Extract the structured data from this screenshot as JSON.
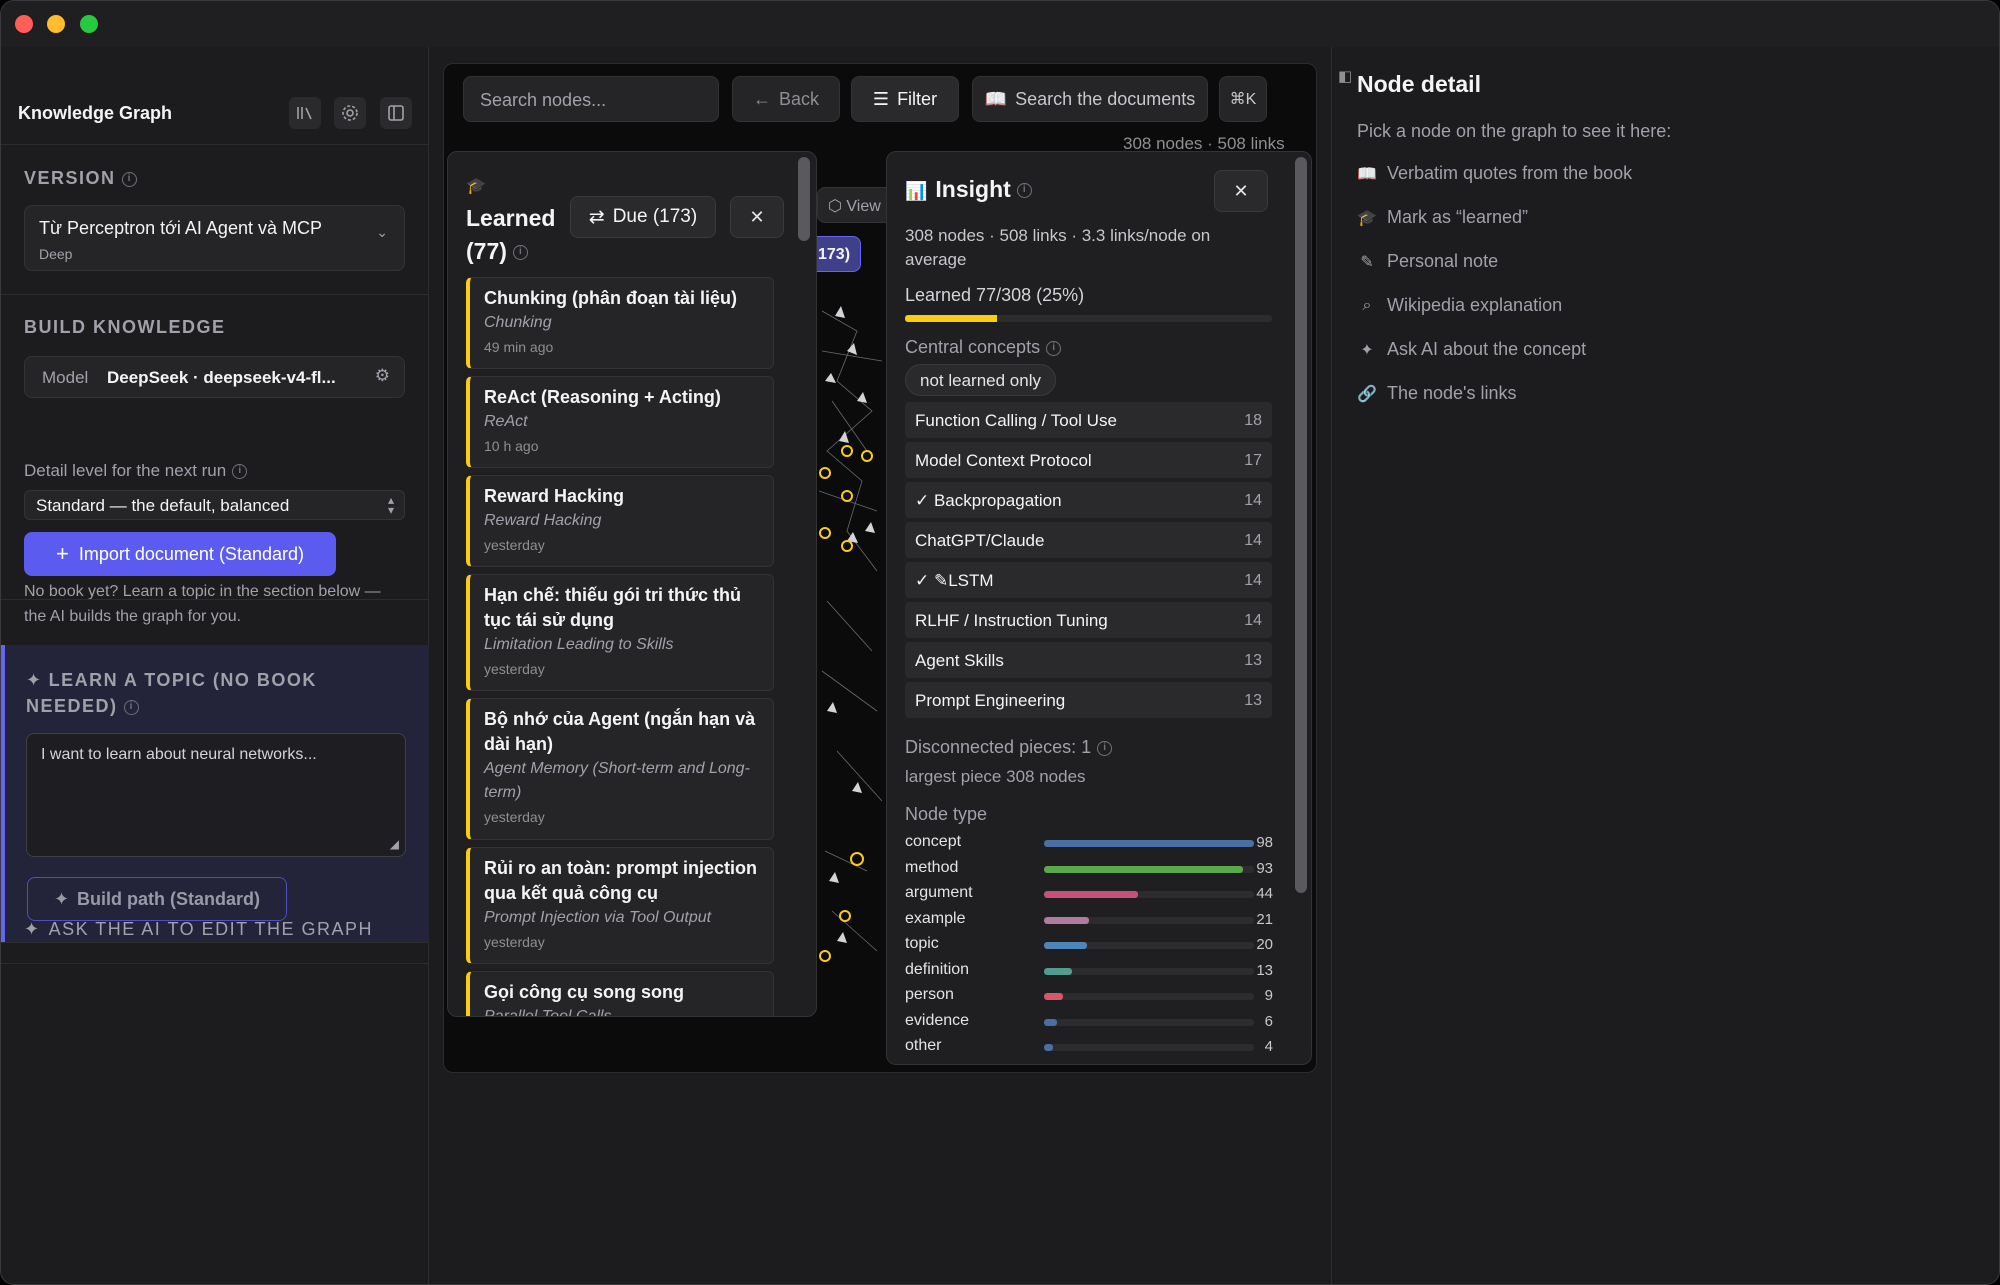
{
  "sidebar": {
    "title": "Knowledge Graph",
    "version_label": "VERSION",
    "version_name": "Từ Perceptron tới AI Agent và MCP",
    "version_sub": "Deep",
    "build_label": "BUILD KNOWLEDGE",
    "model_key": "Model",
    "model_val": "DeepSeek · deepseek-v4-fl...",
    "detail_label": "Detail level for the next run",
    "detail_value": "Standard — the default, balanced",
    "import_btn": "Import document (Standard)",
    "hint": "No book yet? Learn a topic in the section below — the AI builds the graph for you.",
    "learn_title": "LEARN A TOPIC (NO BOOK NEEDED)",
    "learn_placeholder": "I want to learn about neural networks...",
    "build_path_btn": "Build path (Standard)",
    "ask_ai": "ASK THE AI TO EDIT THE GRAPH"
  },
  "toolbar": {
    "search_placeholder": "Search nodes...",
    "back": "Back",
    "filter": "Filter",
    "search_docs": "Search the documents",
    "shortcut": "⌘K",
    "counts": "308 nodes · 508 links",
    "view_partial": "View",
    "due_partial": "173)"
  },
  "learned": {
    "title": "Learned (77)",
    "due_btn": "Due (173)",
    "cards": [
      {
        "title": "Chunking (phân đoạn tài liệu)",
        "sub": "Chunking",
        "time": "49 min ago"
      },
      {
        "title": "ReAct (Reasoning + Acting)",
        "sub": "ReAct",
        "time": "10 h ago"
      },
      {
        "title": "Reward Hacking",
        "sub": "Reward Hacking",
        "time": "yesterday"
      },
      {
        "title": "Hạn chế: thiếu gói tri thức thủ tục tái sử dụng",
        "sub": "Limitation Leading to Skills",
        "time": "yesterday"
      },
      {
        "title": "Bộ nhớ của Agent (ngắn hạn và dài hạn)",
        "sub": "Agent Memory (Short-term and Long-term)",
        "time": "yesterday"
      },
      {
        "title": "Rủi ro an toàn: prompt injection qua kết quả công cụ",
        "sub": "Prompt Injection via Tool Output",
        "time": "yesterday"
      },
      {
        "title": "Gọi công cụ song song",
        "sub": "Parallel Tool Calls",
        "time": ""
      }
    ]
  },
  "insight": {
    "title": "Insight",
    "stats": "308 nodes · 508 links · 3.3 links/node on average",
    "learned": "Learned 77/308 (25%)",
    "learned_fraction": 0.25,
    "central_label": "Central concepts",
    "filter_pill": "not learned only",
    "concepts": [
      {
        "name": "Function Calling / Tool Use",
        "count": "18",
        "prefix": ""
      },
      {
        "name": "Model Context Protocol",
        "count": "17",
        "prefix": ""
      },
      {
        "name": "Backpropagation",
        "count": "14",
        "prefix": "✓ "
      },
      {
        "name": "ChatGPT/Claude",
        "count": "14",
        "prefix": ""
      },
      {
        "name": "LSTM",
        "count": "14",
        "prefix": "✓ ✎"
      },
      {
        "name": "RLHF / Instruction Tuning",
        "count": "14",
        "prefix": ""
      },
      {
        "name": "Agent Skills",
        "count": "13",
        "prefix": ""
      },
      {
        "name": "Prompt Engineering",
        "count": "13",
        "prefix": ""
      }
    ],
    "disconnected": "Disconnected pieces: 1",
    "largest": "largest piece 308 nodes",
    "node_type_label": "Node type",
    "node_types": [
      {
        "label": "concept",
        "count": "98",
        "value": 98,
        "color": "#4a6fa5"
      },
      {
        "label": "method",
        "count": "93",
        "value": 93,
        "color": "#5aa94a"
      },
      {
        "label": "argument",
        "count": "44",
        "value": 44,
        "color": "#c94f7c"
      },
      {
        "label": "example",
        "count": "21",
        "value": 21,
        "color": "#b07aa1"
      },
      {
        "label": "topic",
        "count": "20",
        "value": 20,
        "color": "#4e86b8"
      },
      {
        "label": "definition",
        "count": "13",
        "value": 13,
        "color": "#4f9e8f"
      },
      {
        "label": "person",
        "count": "9",
        "value": 9,
        "color": "#d9576b"
      },
      {
        "label": "evidence",
        "count": "6",
        "value": 6,
        "color": "#4a6fa5"
      },
      {
        "label": "other",
        "count": "4",
        "value": 4,
        "color": "#4a6fa5"
      }
    ]
  },
  "detail": {
    "title": "Node detail",
    "hint": "Pick a node on the graph to see it here:",
    "items": [
      {
        "icon": "book-icon",
        "label": "Verbatim quotes from the book"
      },
      {
        "icon": "graduation-cap-icon",
        "label": "Mark as “learned”"
      },
      {
        "icon": "note-edit-icon",
        "label": "Personal note"
      },
      {
        "icon": "search-icon",
        "label": "Wikipedia explanation"
      },
      {
        "icon": "sparkle-icon",
        "label": "Ask AI about the concept"
      },
      {
        "icon": "link-icon",
        "label": "The node's links"
      }
    ]
  }
}
